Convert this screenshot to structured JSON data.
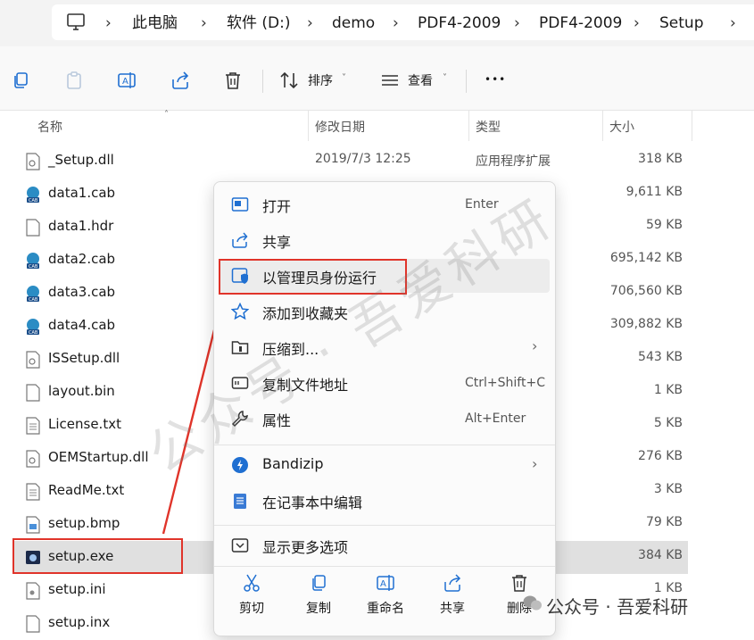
{
  "address_bar": {
    "crumbs": [
      "此电脑",
      "软件 (D:)",
      "demo",
      "PDF4-2009",
      "PDF4-2009",
      "Setup"
    ]
  },
  "toolbar": {
    "sort_label": "排序",
    "view_label": "查看",
    "more_label": "•••"
  },
  "columns": {
    "name": "名称",
    "date": "修改日期",
    "type": "类型",
    "size": "大小"
  },
  "files": [
    {
      "name": "_Setup.dll",
      "date": "2019/7/3 12:25",
      "type": "应用程序扩展",
      "size": "318 KB",
      "icon": "dll-file-icon"
    },
    {
      "name": "data1.cab",
      "date": "",
      "type": "",
      "size": "9,611 KB",
      "icon": "cab-file-icon"
    },
    {
      "name": "data1.hdr",
      "date": "",
      "type": "",
      "size": "59 KB",
      "icon": "generic-file-icon"
    },
    {
      "name": "data2.cab",
      "date": "",
      "type": "",
      "size": "695,142 KB",
      "icon": "cab-file-icon"
    },
    {
      "name": "data3.cab",
      "date": "",
      "type": "",
      "size": "706,560 KB",
      "icon": "cab-file-icon"
    },
    {
      "name": "data4.cab",
      "date": "",
      "type": "",
      "size": "309,882 KB",
      "icon": "cab-file-icon"
    },
    {
      "name": "ISSetup.dll",
      "date": "",
      "type": "",
      "size": "543 KB",
      "icon": "dll-file-icon"
    },
    {
      "name": "layout.bin",
      "date": "",
      "type": "",
      "size": "1 KB",
      "icon": "generic-file-icon"
    },
    {
      "name": "License.txt",
      "date": "",
      "type": "",
      "size": "5 KB",
      "icon": "text-file-icon"
    },
    {
      "name": "OEMStartup.dll",
      "date": "",
      "type": "",
      "size": "276 KB",
      "icon": "dll-file-icon"
    },
    {
      "name": "ReadMe.txt",
      "date": "",
      "type": "",
      "size": "3 KB",
      "icon": "text-file-icon"
    },
    {
      "name": "setup.bmp",
      "date": "",
      "type": "",
      "size": "79 KB",
      "icon": "image-file-icon"
    },
    {
      "name": "setup.exe",
      "date": "",
      "type": "",
      "size": "384 KB",
      "icon": "exe-file-icon"
    },
    {
      "name": "setup.ini",
      "date": "",
      "type": "",
      "size": "1 KB",
      "icon": "ini-file-icon"
    },
    {
      "name": "setup.inx",
      "date": "",
      "type": "",
      "size": "",
      "icon": "generic-file-icon"
    }
  ],
  "context_menu": {
    "items": [
      {
        "label": "打开",
        "shortcut": "Enter",
        "icon": "open-window-icon"
      },
      {
        "label": "共享",
        "shortcut": "",
        "icon": "share-icon"
      },
      {
        "label": "以管理员身份运行",
        "shortcut": "",
        "icon": "shield-icon"
      },
      {
        "label": "添加到收藏夹",
        "shortcut": "",
        "icon": "star-icon"
      },
      {
        "label": "压缩到...",
        "shortcut": "",
        "icon": "zip-folder-icon"
      },
      {
        "label": "复制文件地址",
        "shortcut": "Ctrl+Shift+C",
        "icon": "copy-path-icon"
      },
      {
        "label": "属性",
        "shortcut": "Alt+Enter",
        "icon": "wrench-icon"
      },
      {
        "label": "Bandizip",
        "shortcut": "",
        "icon": "bandizip-icon"
      },
      {
        "label": "在记事本中编辑",
        "shortcut": "",
        "icon": "notepad-icon"
      },
      {
        "label": "显示更多选项",
        "shortcut": "",
        "icon": "more-options-icon"
      }
    ],
    "quick_actions": [
      "剪切",
      "复制",
      "重命名",
      "共享",
      "删除"
    ]
  },
  "watermark": {
    "diagonal": "公众号 · 吾爱科研",
    "corner": "公众号 · 吾爱科研"
  },
  "colors": {
    "highlight_red": "#e0342a",
    "accent_blue": "#1f6fd1",
    "selected_row": "#e0e0e0"
  }
}
